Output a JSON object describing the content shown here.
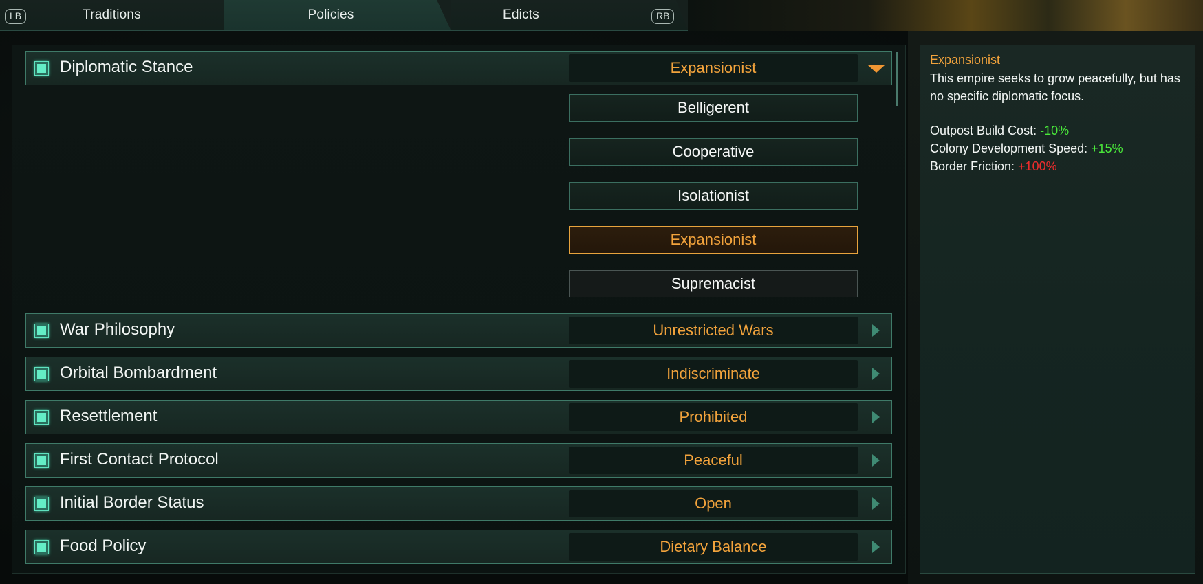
{
  "tabs": {
    "left_button": "LB",
    "right_button": "RB",
    "items": [
      "Traditions",
      "Policies",
      "Edicts"
    ],
    "active": "Policies"
  },
  "policies": [
    {
      "title": "Diplomatic Stance",
      "value": "Expansionist",
      "expanded": true
    },
    {
      "title": "War Philosophy",
      "value": "Unrestricted Wars",
      "expanded": false
    },
    {
      "title": "Orbital Bombardment",
      "value": "Indiscriminate",
      "expanded": false
    },
    {
      "title": "Resettlement",
      "value": "Prohibited",
      "expanded": false
    },
    {
      "title": "First Contact Protocol",
      "value": "Peaceful",
      "expanded": false
    },
    {
      "title": "Initial Border Status",
      "value": "Open",
      "expanded": false
    },
    {
      "title": "Food Policy",
      "value": "Dietary Balance",
      "expanded": false
    }
  ],
  "dropdown_options": [
    {
      "label": "Belligerent",
      "state": "available"
    },
    {
      "label": "Cooperative",
      "state": "available"
    },
    {
      "label": "Isolationist",
      "state": "available"
    },
    {
      "label": "Expansionist",
      "state": "selected"
    },
    {
      "label": "Supremacist",
      "state": "unavailable"
    }
  ],
  "info": {
    "title": "Expansionist",
    "description": "This empire seeks to grow peacefully, but has no specific diplomatic focus.",
    "effects": [
      {
        "label": "Outpost Build Cost: ",
        "value": "-10%",
        "positive": true
      },
      {
        "label": "Colony Development Speed: ",
        "value": "+15%",
        "positive": true
      },
      {
        "label": "Border Friction: ",
        "value": "+100%",
        "positive": false
      }
    ]
  },
  "colors": {
    "accent_orange": "#f2a33c",
    "accent_teal": "#3f7a68",
    "positive_green": "#49e83a",
    "negative_red": "#ee2d2d"
  }
}
